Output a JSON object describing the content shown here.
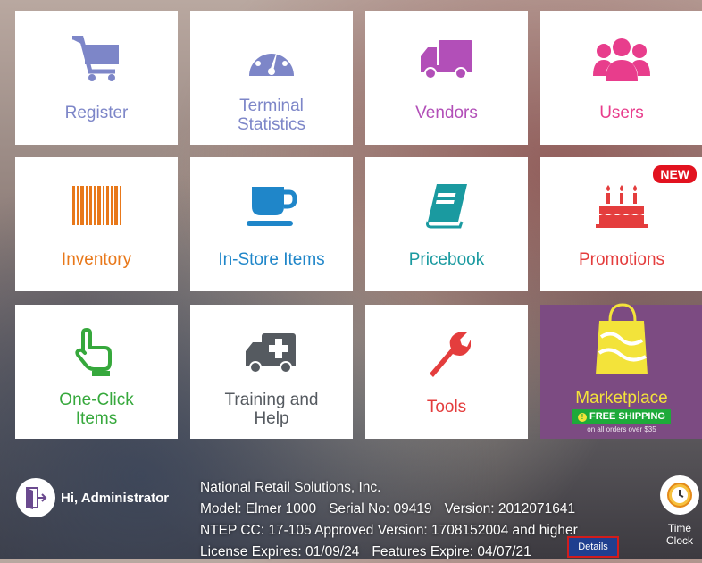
{
  "tiles": {
    "register": {
      "label": "Register",
      "color": "#7d86c8",
      "icon": "cart-icon"
    },
    "terminal": {
      "label": "Terminal\nStatistics",
      "line1": "Terminal",
      "line2": "Statistics",
      "color": "#7d86c8",
      "icon": "dashboard-gauge-icon"
    },
    "vendors": {
      "label": "Vendors",
      "color": "#b24fb8",
      "icon": "truck-icon"
    },
    "users": {
      "label": "Users",
      "color": "#e83d8c",
      "icon": "users-group-icon"
    },
    "inventory": {
      "label": "Inventory",
      "color": "#e8781a",
      "icon": "barcode-icon"
    },
    "instore": {
      "label": "In-Store Items",
      "color": "#1f86c9",
      "icon": "coffee-cup-icon"
    },
    "pricebook": {
      "label": "Pricebook",
      "color": "#1a9aa0",
      "icon": "book-icon"
    },
    "promotions": {
      "label": "Promotions",
      "color": "#e43d3d",
      "icon": "cake-icon",
      "badge": "NEW"
    },
    "oneclick": {
      "line1": "One-Click",
      "line2": "Items",
      "color": "#36a83c",
      "icon": "pointing-hand-icon"
    },
    "training": {
      "line1": "Training and",
      "line2": "Help",
      "color": "#555a60",
      "icon": "ambulance-icon"
    },
    "tools": {
      "label": "Tools",
      "color": "#e43d3d",
      "icon": "wrench-icon"
    },
    "marketplace": {
      "label": "Marketplace",
      "ship_label": "FREE SHIPPING",
      "ship_note": "on all orders over $35",
      "icon": "shopping-bag-icon"
    }
  },
  "footer": {
    "greeting": "Hi, Administrator",
    "company": "National Retail Solutions, Inc.",
    "model": "Model: Elmer 1000",
    "serial": "Serial No: 09419",
    "version": "Version: 2012071641",
    "ntep": "NTEP CC: 17-105 Approved Version: 1708152004 and higher",
    "license": "License Expires: 01/09/24",
    "features": "Features Expire: 04/07/21",
    "details_label": "Details",
    "clock_line1": "Time",
    "clock_line2": "Clock"
  }
}
